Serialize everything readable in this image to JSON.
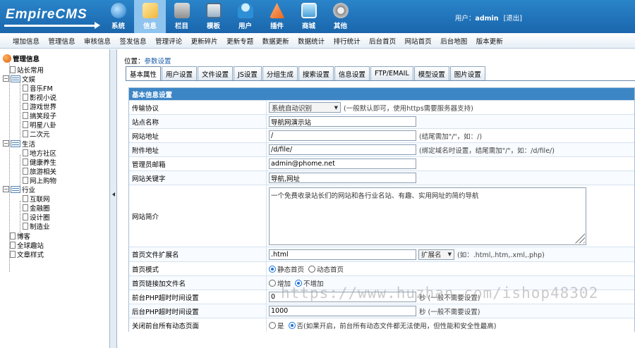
{
  "app": {
    "logo": "EmpireCMS",
    "user_prefix": "用户：",
    "username": "admin",
    "logout": "[退出]"
  },
  "mainnav": [
    {
      "label": "系统",
      "icon": "globe-icon"
    },
    {
      "label": "信息",
      "icon": "edit-icon",
      "active": true
    },
    {
      "label": "栏目",
      "icon": "folder-icon"
    },
    {
      "label": "模板",
      "icon": "template-icon"
    },
    {
      "label": "用户",
      "icon": "user-icon"
    },
    {
      "label": "插件",
      "icon": "plugin-icon"
    },
    {
      "label": "商城",
      "icon": "shop-icon"
    },
    {
      "label": "其他",
      "icon": "gear-icon"
    }
  ],
  "subnav": [
    "增加信息",
    "管理信息",
    "审核信息",
    "签发信息",
    "管理评论",
    "更新碎片",
    "更新专题",
    "数据更新",
    "数据统计",
    "排行统计",
    "后台首页",
    "网站首页",
    "后台地图",
    "版本更新"
  ],
  "sidebar": {
    "root": "管理信息",
    "items": [
      "站长常用",
      "文娱",
      "音乐FM",
      "影视小说",
      "游戏世界",
      "搞笑段子",
      "明星八卦",
      "二次元",
      "生活",
      "地方社区",
      "健康养生",
      "旅游相关",
      "网上购物",
      "行业",
      "互联网",
      "金融圈",
      "设计圈",
      "制造业",
      "博客",
      "全球趣站",
      "文章样式"
    ]
  },
  "breadcrumb": {
    "prefix": "位置：",
    "link": "参数设置"
  },
  "tabs": [
    "基本属性",
    "用户设置",
    "文件设置",
    "JS设置",
    "分组生成",
    "搜索设置",
    "信息设置",
    "FTP/EMAIL",
    "模型设置",
    "图片设置"
  ],
  "form": {
    "header": "基本信息设置",
    "protocol": {
      "label": "传输协议",
      "value": "系统自动识别",
      "hint": "(一般默认即可，使用https需要服务器支持)"
    },
    "sitename": {
      "label": "站点名称",
      "value": "导航网演示站"
    },
    "siteurl": {
      "label": "网站地址",
      "value": "/",
      "hint": "(结尾需加\"/\"，如：/)"
    },
    "fileurl": {
      "label": "附件地址",
      "value": "/d/file/",
      "hint": "(绑定域名时设置，结尾需加\"/\"，如：/d/file/)"
    },
    "email": {
      "label": "管理员邮箱",
      "value": "admin@phome.net"
    },
    "keywords": {
      "label": "网站关键字",
      "value": "导航,网址"
    },
    "intro": {
      "label": "网站简介",
      "value": "一个免费收录站长们的网站和各行业名站、有趣、实用网址的简约导航"
    },
    "ext": {
      "label": "首页文件扩展名",
      "value": ".html",
      "select": "扩展名",
      "hint": "(如：.html,.htm,.xml,.php)"
    },
    "mode": {
      "label": "首页模式",
      "opt1": "静态首页",
      "opt2": "动态首页"
    },
    "addfile": {
      "label": "首页链接加文件名",
      "opt1": "增加",
      "opt2": "不增加"
    },
    "frontphp": {
      "label": "前台PHP超时时间设置",
      "value": "0",
      "hint": "秒 (一般不需要设置)"
    },
    "backphp": {
      "label": "后台PHP超时时间设置",
      "value": "1000",
      "hint": "秒 (一般不需要设置)"
    },
    "closedyn": {
      "label": "关闭前台所有动态页面",
      "opt1": "是",
      "opt2": "否(如果开启，前台所有动态文件都无法使用，但性能和安全性最高)"
    }
  },
  "watermark": "https://www.huzhan.com/ishop48302"
}
